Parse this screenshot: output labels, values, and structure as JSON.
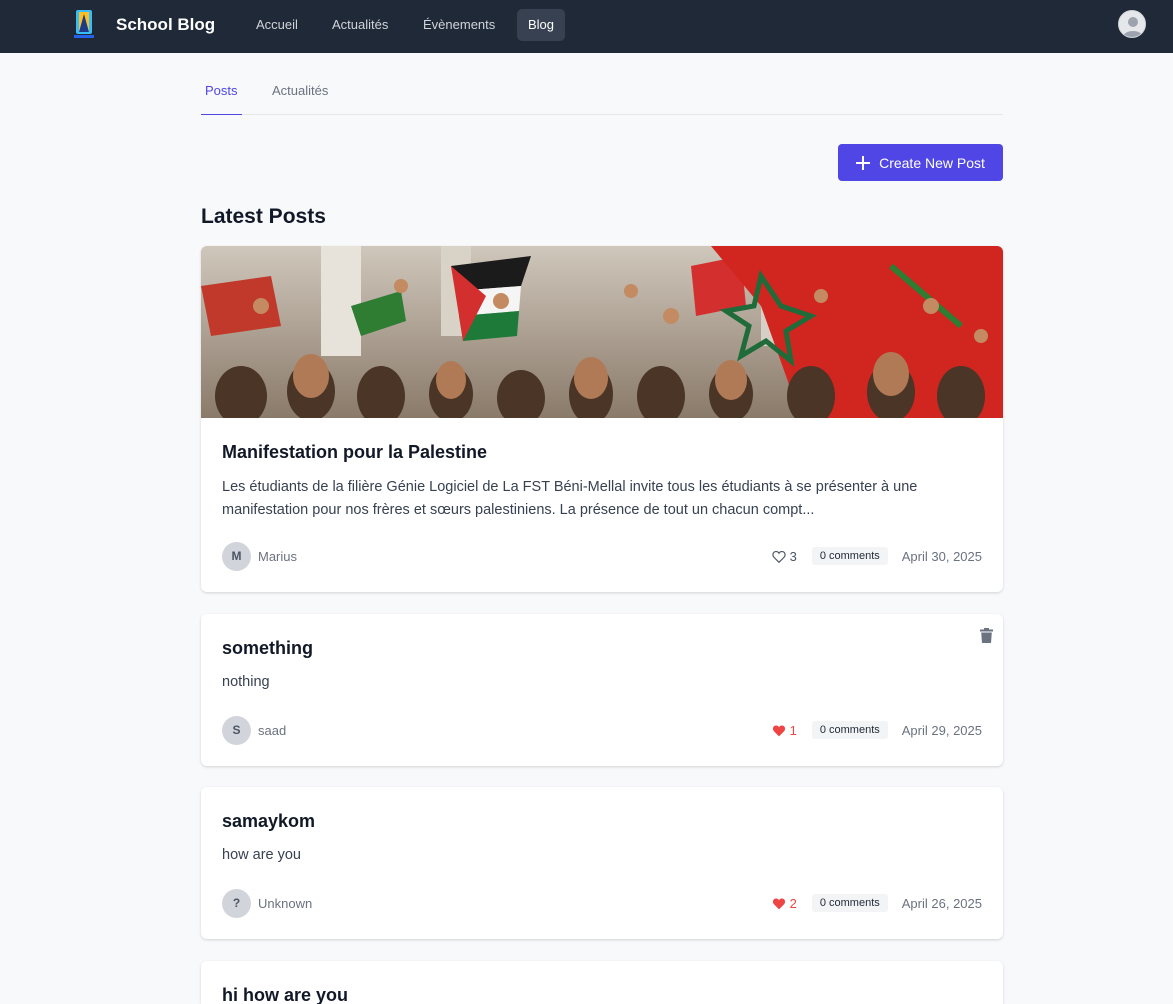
{
  "brand": {
    "name": "School Blog"
  },
  "nav": {
    "links": [
      {
        "label": "Accueil"
      },
      {
        "label": "Actualités"
      },
      {
        "label": "Évènements"
      },
      {
        "label": "Blog"
      }
    ],
    "active": "Blog"
  },
  "tabs": [
    {
      "label": "Posts"
    },
    {
      "label": "Actualités"
    }
  ],
  "active_tab": "Posts",
  "create_button": {
    "label": "Create New Post",
    "icon": "plus-icon"
  },
  "section_title": "Latest Posts",
  "posts": [
    {
      "title": "Manifestation pour la Palestine",
      "excerpt": "Les étudiants de la filière Génie Logiciel de La FST Béni-Mellal invite tous les étudiants à se présenter à une manifestation pour nos frères et sœurs palestiniens. La présence de tout un chacun compt...",
      "author_initial": "M",
      "author": "Marius",
      "likes": "3",
      "liked": false,
      "comments": "0 comments",
      "date": "April 30, 2025",
      "has_image": true,
      "deletable": false
    },
    {
      "title": "something",
      "excerpt": "nothing",
      "author_initial": "S",
      "author": "saad",
      "likes": "1",
      "liked": true,
      "comments": "0 comments",
      "date": "April 29, 2025",
      "has_image": false,
      "deletable": true
    },
    {
      "title": "samaykom",
      "excerpt": "how are you",
      "author_initial": "?",
      "author": "Unknown",
      "likes": "2",
      "liked": true,
      "comments": "0 comments",
      "date": "April 26, 2025",
      "has_image": false,
      "deletable": false
    },
    {
      "title": "hi how are you"
    }
  ],
  "colors": {
    "navbar": "#1f2937",
    "accent": "#4f46e5",
    "like": "#ef4444",
    "background": "#f8f9fb"
  }
}
